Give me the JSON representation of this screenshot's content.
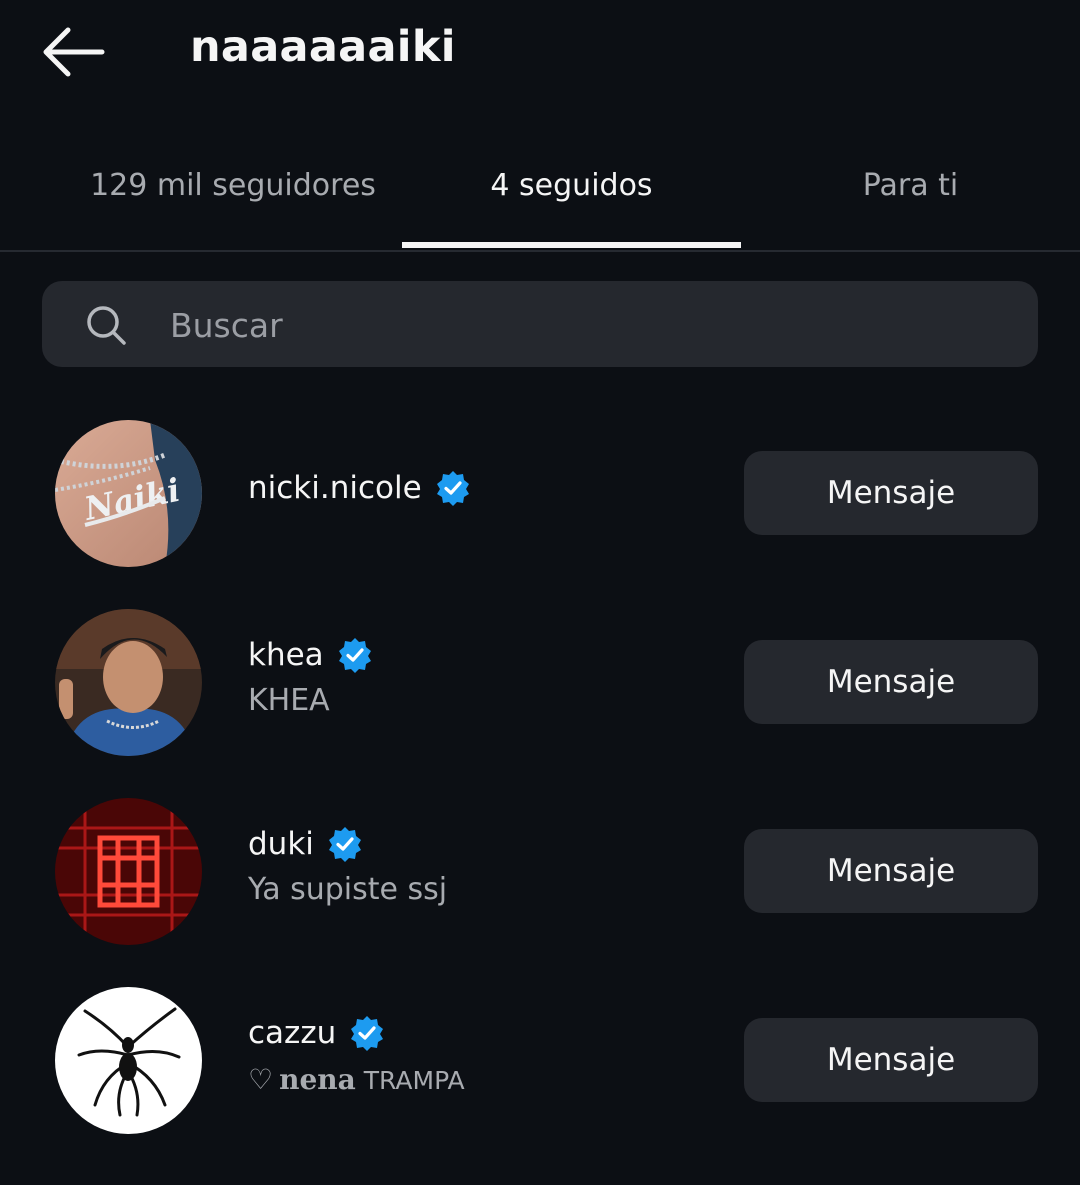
{
  "header": {
    "title": "naaaaaaiki"
  },
  "tabs": [
    {
      "label": "129 mil seguidores"
    },
    {
      "label": "4 seguidos"
    },
    {
      "label": "Para ti"
    }
  ],
  "search": {
    "placeholder": "Buscar"
  },
  "accounts": [
    {
      "username": "nicki.nicole",
      "subtitle": "",
      "verified": true,
      "button": "Mensaje"
    },
    {
      "username": "khea",
      "subtitle": "KHEA",
      "verified": true,
      "button": "Mensaje"
    },
    {
      "username": "duki",
      "subtitle": "Ya supiste ssj",
      "verified": true,
      "button": "Mensaje"
    },
    {
      "username": "cazzu",
      "subtitle_parts": {
        "heart": "♡",
        "word1": "nena",
        "word2": "TRAMPA"
      },
      "verified": true,
      "button": "Mensaje"
    }
  ],
  "colors": {
    "background": "#0c0f14",
    "surface": "#25282e",
    "verified_badge": "#1d9bf0",
    "text_primary": "#f5f5f5",
    "text_secondary": "#a8abb0"
  }
}
